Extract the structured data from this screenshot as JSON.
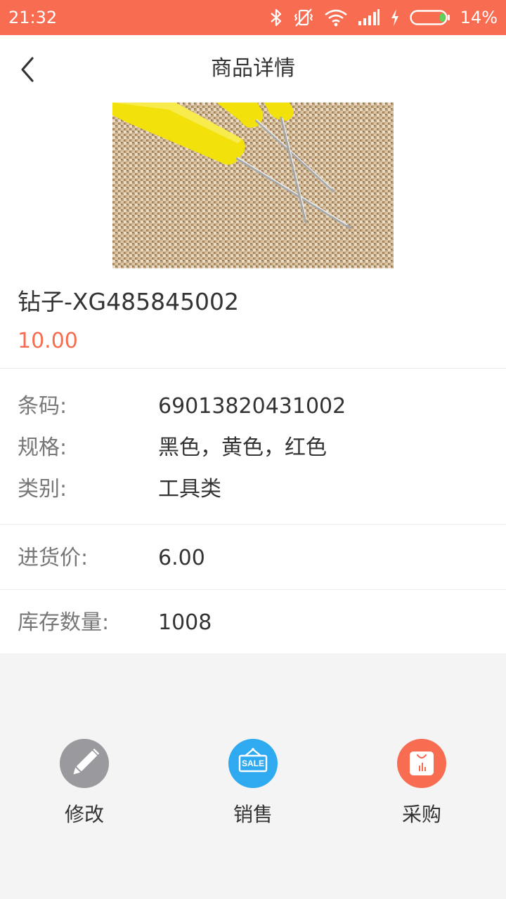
{
  "status_bar": {
    "time": "21:32",
    "battery_percent": "14%",
    "battery_level": 0.14,
    "icons": [
      "bluetooth-icon",
      "vibrate-off-icon",
      "wifi-icon",
      "signal-icon",
      "charging-icon",
      "battery-icon"
    ]
  },
  "header": {
    "title": "商品详情",
    "back_icon": "chevron-left-icon"
  },
  "product": {
    "image": "awl-tools-photo",
    "name": "钻子-XG485845002",
    "price": "10.00"
  },
  "details": {
    "barcode_label": "条码:",
    "barcode_value": "69013820431002",
    "spec_label": "规格:",
    "spec_value": "黑色，黄色，红色",
    "category_label": "类别:",
    "category_value": "工具类",
    "purchase_price_label": "进货价:",
    "purchase_price_value": "6.00",
    "stock_label": "库存数量:",
    "stock_value": "1008"
  },
  "actions": {
    "edit_label": "修改",
    "sale_label": "销售",
    "sale_icon_text": "SALE",
    "purchase_label": "采购"
  },
  "colors": {
    "accent": "#f86c51",
    "edit_icon_bg": "#9a9a9e",
    "sale_icon_bg": "#2fa9f0",
    "purchase_icon_bg": "#f86c51",
    "page_bg": "#f4f4f4"
  }
}
